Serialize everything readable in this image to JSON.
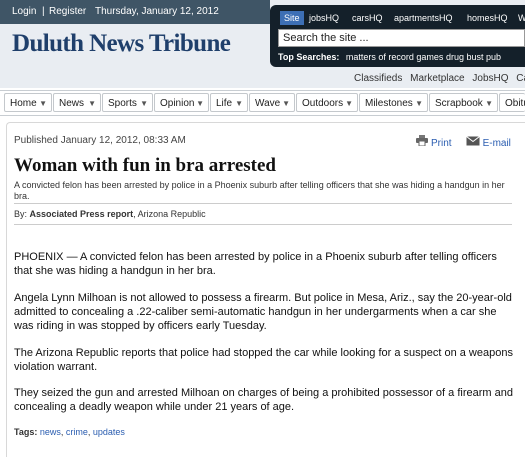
{
  "topbar": {
    "login": "Login",
    "separator": "|",
    "register": "Register",
    "date": "Thursday, January 12, 2012"
  },
  "masthead": {
    "title": "Duluth News Tribune"
  },
  "search": {
    "tabs": [
      "Site",
      "jobsHQ",
      "carsHQ",
      "apartmentsHQ",
      "homesHQ",
      "W"
    ],
    "input_value": "Search the site ...",
    "top_label": "Top Searches:",
    "top_items": [
      "matters of record",
      "games",
      "drug bust",
      "pub"
    ]
  },
  "utility_links": [
    "Classifieds",
    "Marketplace",
    "JobsHQ",
    "Cars"
  ],
  "nav": [
    "Home",
    "News",
    "Sports",
    "Opinion",
    "Life",
    "Wave",
    "Outdoors",
    "Milestones",
    "Scrapbook",
    "Obitu"
  ],
  "article": {
    "published": "Published January 12, 2012, 08:33 AM",
    "print_label": "Print",
    "email_label": "E-mail",
    "headline": "Woman with fun in bra arrested",
    "summary": "A convicted felon has been arrested by police in a Phoenix suburb after telling officers that she was hiding a handgun in her bra.",
    "by_label": "By:",
    "by_author": "Associated Press report",
    "by_source": ", Arizona Republic",
    "paragraphs": [
      "PHOENIX — A convicted felon has been arrested by police in a Phoenix suburb after telling officers that she was hiding a handgun in her bra.",
      "Angela Lynn Milhoan is not allowed to possess a firearm. But police in Mesa, Ariz., say the 20-year-old admitted to concealing a .22-caliber semi-automatic handgun in her undergarments when a car she was riding in was stopped by officers early Tuesday.",
      "The Arizona Republic reports that police had stopped the car while looking for a suspect on a weapons violation warrant.",
      "They seized the gun and arrested Milhoan on charges of being a prohibited possessor of a firearm and concealing a deadly weapon while under 21 years of age."
    ],
    "tags_label": "Tags:",
    "tags": [
      "news",
      "crime",
      "updates"
    ]
  }
}
